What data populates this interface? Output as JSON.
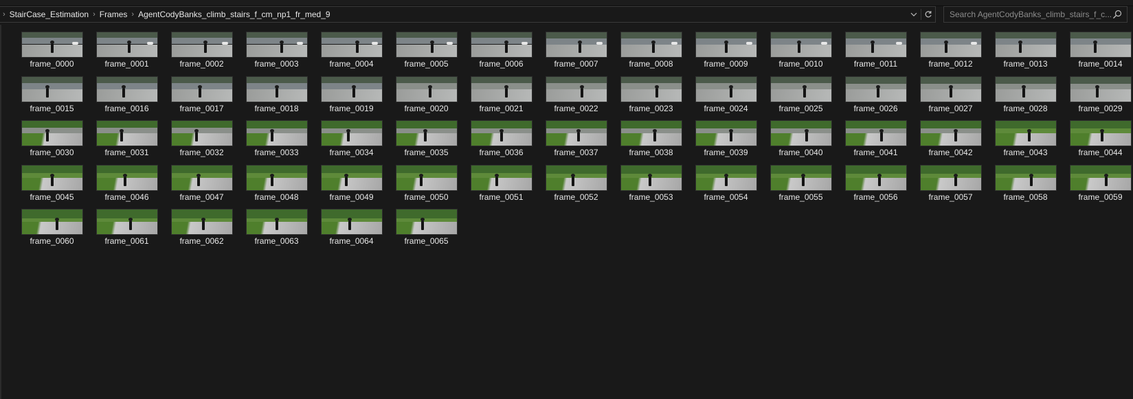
{
  "breadcrumb": [
    "StairCase_Estimation",
    "Frames",
    "AgentCodyBanks_climb_stairs_f_cm_np1_fr_med_9"
  ],
  "search": {
    "placeholder": "Search AgentCodyBanks_climb_stairs_f_c..."
  },
  "icons": {
    "breadcrumb_separator": "chevron-right-icon",
    "history_dropdown": "chevron-down-icon",
    "refresh": "refresh-icon",
    "search": "search-icon"
  },
  "colors": {
    "background": "#191919",
    "text": "#e8e8e8",
    "border": "#3a3a3a"
  },
  "files": [
    "frame_0000",
    "frame_0001",
    "frame_0002",
    "frame_0003",
    "frame_0004",
    "frame_0005",
    "frame_0006",
    "frame_0007",
    "frame_0008",
    "frame_0009",
    "frame_0010",
    "frame_0011",
    "frame_0012",
    "frame_0013",
    "frame_0014",
    "frame_0015",
    "frame_0016",
    "frame_0017",
    "frame_0018",
    "frame_0019",
    "frame_0020",
    "frame_0021",
    "frame_0022",
    "frame_0023",
    "frame_0024",
    "frame_0025",
    "frame_0026",
    "frame_0027",
    "frame_0028",
    "frame_0029",
    "frame_0030",
    "frame_0031",
    "frame_0032",
    "frame_0033",
    "frame_0034",
    "frame_0035",
    "frame_0036",
    "frame_0037",
    "frame_0038",
    "frame_0039",
    "frame_0040",
    "frame_0041",
    "frame_0042",
    "frame_0043",
    "frame_0044",
    "frame_0045",
    "frame_0046",
    "frame_0047",
    "frame_0048",
    "frame_0049",
    "frame_0050",
    "frame_0051",
    "frame_0052",
    "frame_0053",
    "frame_0054",
    "frame_0055",
    "frame_0056",
    "frame_0057",
    "frame_0058",
    "frame_0059",
    "frame_0060",
    "frame_0061",
    "frame_0062",
    "frame_0063",
    "frame_0064",
    "frame_0065"
  ]
}
